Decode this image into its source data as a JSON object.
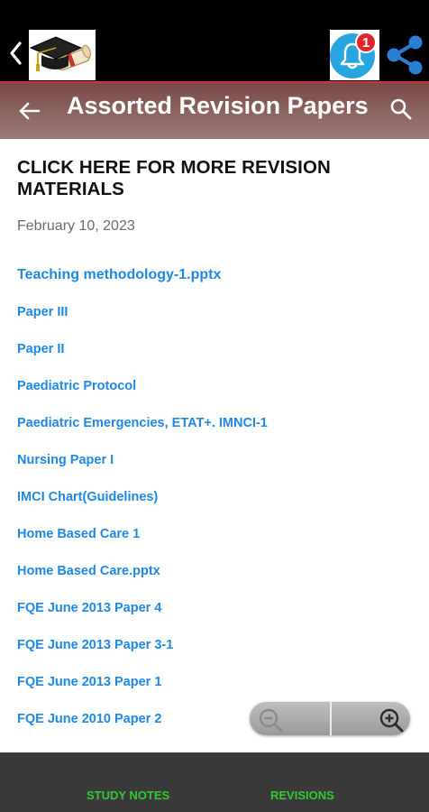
{
  "header": {
    "notification_count": "1"
  },
  "app_bar": {
    "title": "Assorted Revision Papers"
  },
  "post": {
    "heading_line1": "CLICK HERE FOR MORE REVISION",
    "heading_line2": "MATERIALS",
    "date": "February 10, 2023",
    "links": [
      "Teaching methodology-1.pptx",
      "Paper III",
      "Paper II",
      "Paediatric Protocol",
      "Paediatric Emergencies, ETAT+. IMNCI-1",
      "Nursing Paper I",
      "IMCI Chart(Guidelines)",
      "Home Based Care 1",
      "Home Based Care.pptx",
      "FQE June 2013 Paper 4",
      "FQE June 2013 Paper 3-1",
      "FQE June 2013 Paper 1",
      "FQE June 2010 Paper 2"
    ]
  },
  "bottom_nav": {
    "items": [
      "STUDY NOTES",
      "REVISIONS"
    ]
  },
  "colors": {
    "link": "#1e88e5",
    "nav_label": "#31c931",
    "badge": "#e0262b",
    "bell": "#29a6e0"
  }
}
